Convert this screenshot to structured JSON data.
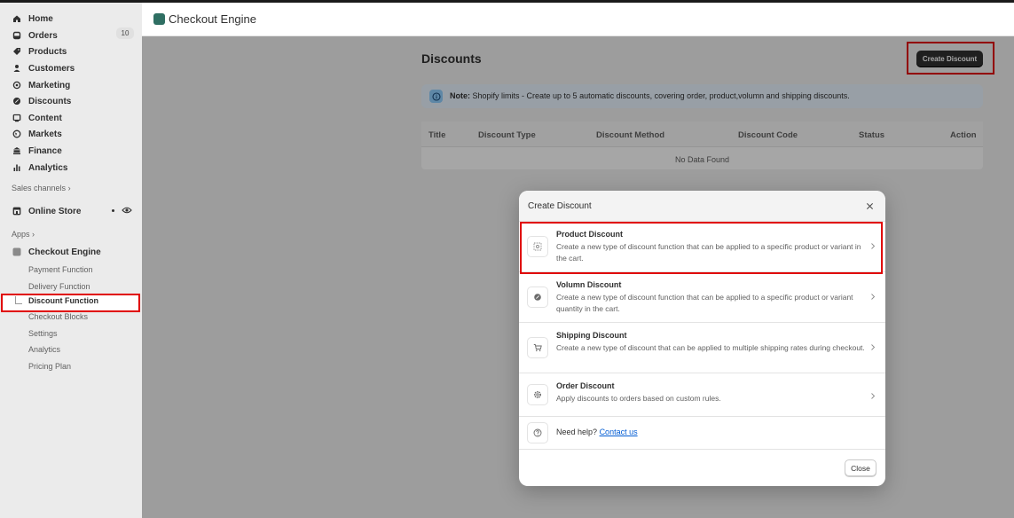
{
  "sidebar": {
    "nav": [
      {
        "label": "Home",
        "icon": "home-icon"
      },
      {
        "label": "Orders",
        "icon": "orders-icon",
        "badge": "10"
      },
      {
        "label": "Products",
        "icon": "tag-icon"
      },
      {
        "label": "Customers",
        "icon": "person-icon"
      },
      {
        "label": "Marketing",
        "icon": "target-icon"
      },
      {
        "label": "Discounts",
        "icon": "discount-icon"
      },
      {
        "label": "Content",
        "icon": "content-icon"
      },
      {
        "label": "Markets",
        "icon": "globe-icon"
      },
      {
        "label": "Finance",
        "icon": "bank-icon"
      },
      {
        "label": "Analytics",
        "icon": "bar-chart-icon"
      }
    ],
    "sales_channels_label": "Sales channels",
    "online_store_label": "Online Store",
    "apps_label": "Apps",
    "app_name": "Checkout Engine",
    "app_sub_items": [
      {
        "label": "Payment Function"
      },
      {
        "label": "Delivery Function"
      },
      {
        "label": "Discount Function",
        "active": true
      },
      {
        "label": "Checkout Blocks"
      },
      {
        "label": "Settings"
      },
      {
        "label": "Analytics"
      },
      {
        "label": "Pricing Plan"
      }
    ]
  },
  "header": {
    "title": "Checkout Engine"
  },
  "page": {
    "title": "Discounts",
    "create_button": "Create Discount",
    "banner_note_label": "Note:",
    "banner_note_text": "Shopify limits - Create up to 5 automatic discounts, covering order, product,volumn and shipping discounts.",
    "table": {
      "columns": [
        "Title",
        "Discount Type",
        "Discount Method",
        "Discount Code",
        "Status",
        "Action"
      ],
      "empty_text": "No Data Found"
    }
  },
  "modal": {
    "title": "Create Discount",
    "options": [
      {
        "title": "Product Discount",
        "description": "Create a new type of discount function that can be applied to a specific product or variant in the cart."
      },
      {
        "title": "Volumn Discount",
        "description": "Create a new type of discount function that can be applied to a specific product or variant quantity in the cart."
      },
      {
        "title": "Shipping Discount",
        "description": "Create a new type of discount that can be applied to multiple shipping rates during checkout."
      },
      {
        "title": "Order Discount",
        "description": "Apply discounts to orders based on custom rules."
      }
    ],
    "help_text": "Need help?",
    "help_link": "Contact us",
    "close_button": "Close"
  },
  "colors": {
    "highlight": "#e00000",
    "primary_button": "#303030",
    "link": "#005bd3",
    "banner_bg": "#eaf4ff",
    "app_icon": "#2f6f63"
  }
}
